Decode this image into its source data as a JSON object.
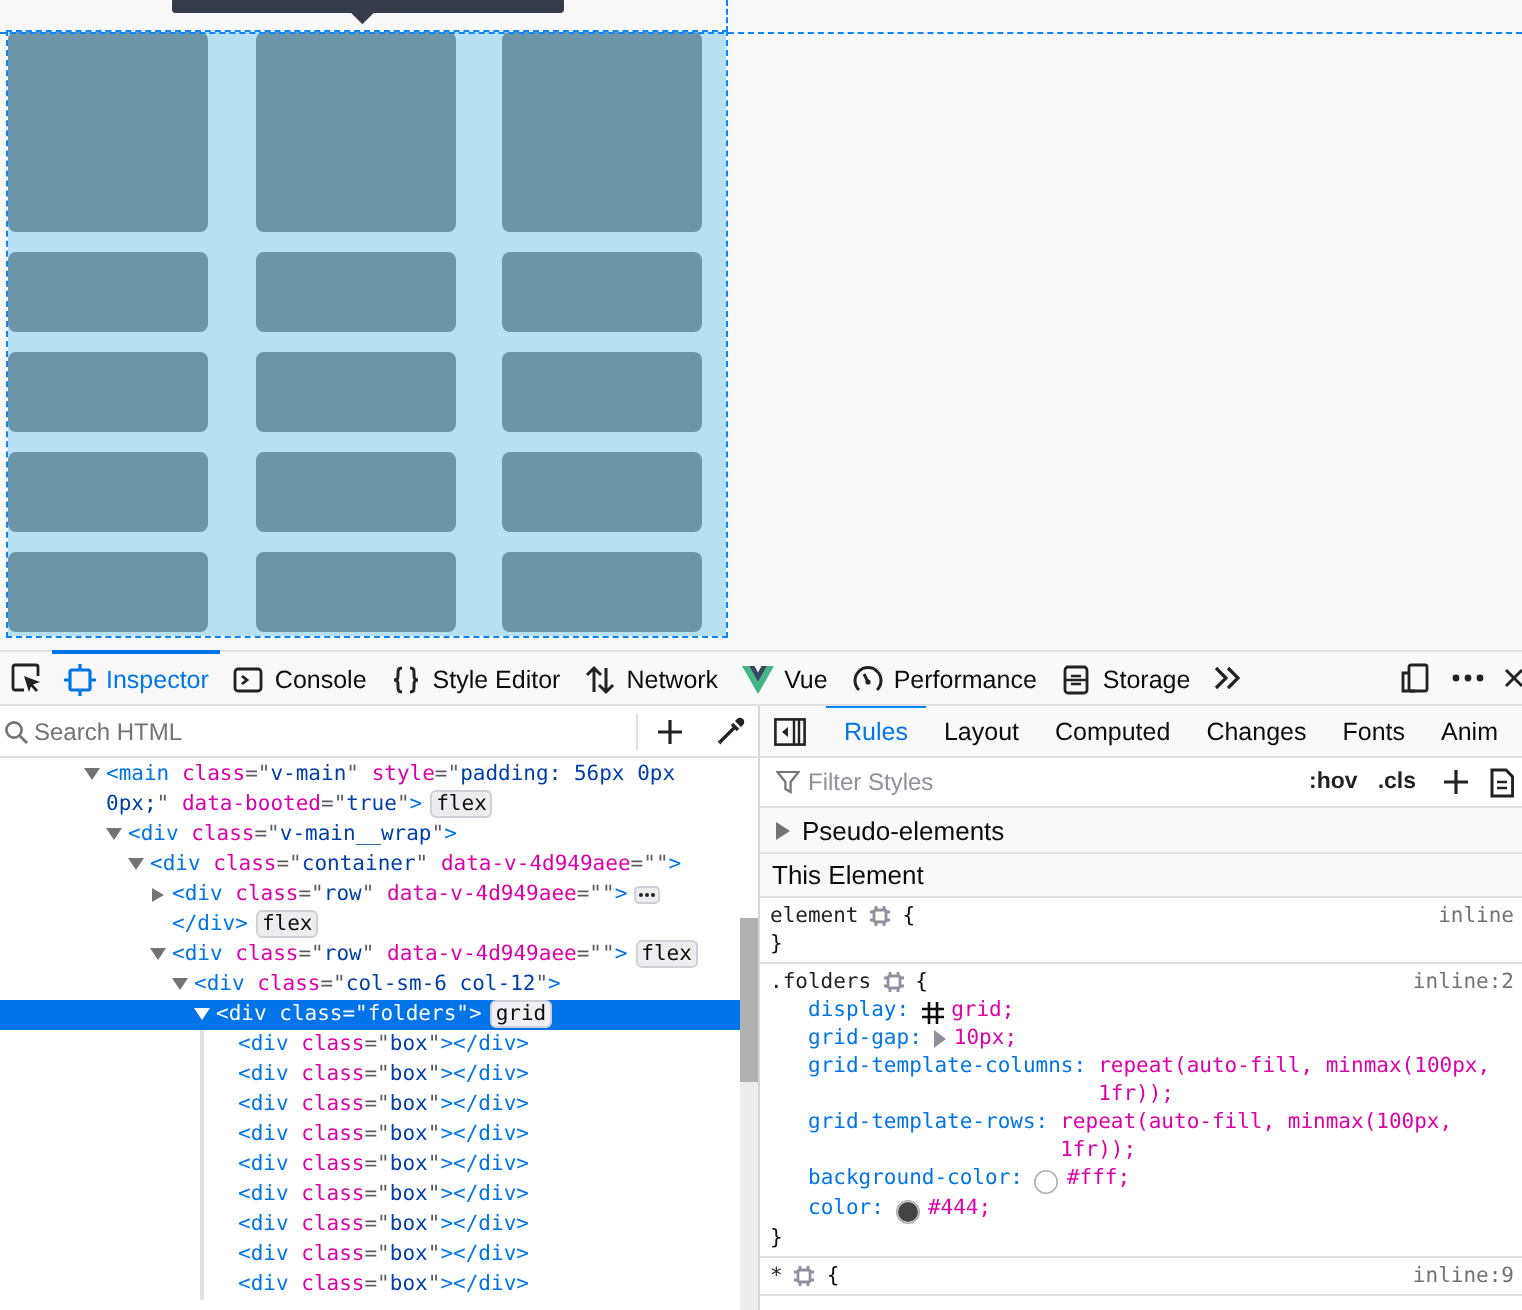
{
  "toolbar": {
    "tabs": [
      {
        "kind": "inspector",
        "label": "Inspector",
        "selected": true
      },
      {
        "kind": "console",
        "label": "Console",
        "selected": false
      },
      {
        "kind": "style-editor",
        "label": "Style Editor",
        "selected": false
      },
      {
        "kind": "network",
        "label": "Network",
        "selected": false
      },
      {
        "kind": "vue",
        "label": "Vue",
        "selected": false
      },
      {
        "kind": "performance",
        "label": "Performance",
        "selected": false
      },
      {
        "kind": "storage",
        "label": "Storage",
        "selected": false
      }
    ]
  },
  "markup_panel": {
    "search": {
      "placeholder": "Search HTML"
    },
    "tree": [
      {
        "open_lines": [
          "<main class=\"v-main\" style=\"padding: 56px 0px",
          "0px;\" data-booted=\"true\">"
        ],
        "badge": "flex",
        "expanded": true,
        "selected": false,
        "children": [
          {
            "open": "<div class=\"v-main__wrap\">",
            "expanded": true,
            "selected": false,
            "children": [
              {
                "open": "<div class=\"container\" data-v-4d949aee=\"\">",
                "expanded": true,
                "selected": false,
                "children": [
                  {
                    "open": "<div class=\"row\" data-v-4d949aee=\"\">",
                    "close": "</div>",
                    "badge": "flex",
                    "expanded": false,
                    "selected": false
                  },
                  {
                    "open": "<div class=\"row\" data-v-4d949aee=\"\">",
                    "badge": "flex",
                    "expanded": true,
                    "selected": false,
                    "children": [
                      {
                        "open": "<div class=\"col-sm-6 col-12\">",
                        "expanded": true,
                        "selected": false,
                        "children": [
                          {
                            "open": "<div class=\"folders\">",
                            "badge": "grid",
                            "expanded": true,
                            "selected": true,
                            "children": [
                              {
                                "open": "<div class=\"box\"></div>",
                                "selected": false
                              },
                              {
                                "open": "<div class=\"box\"></div>",
                                "selected": false
                              },
                              {
                                "open": "<div class=\"box\"></div>",
                                "selected": false
                              },
                              {
                                "open": "<div class=\"box\"></div>",
                                "selected": false
                              },
                              {
                                "open": "<div class=\"box\"></div>",
                                "selected": false
                              },
                              {
                                "open": "<div class=\"box\"></div>",
                                "selected": false
                              },
                              {
                                "open": "<div class=\"box\"></div>",
                                "selected": false
                              },
                              {
                                "open": "<div class=\"box\"></div>",
                                "selected": false
                              },
                              {
                                "open": "<div class=\"box\"></div>",
                                "selected": false
                              }
                            ]
                          }
                        ]
                      }
                    ]
                  }
                ]
              }
            ]
          }
        ]
      }
    ]
  },
  "rules_panel": {
    "tabs": [
      {
        "label": "Rules",
        "selected": true
      },
      {
        "label": "Layout",
        "selected": false
      },
      {
        "label": "Computed",
        "selected": false
      },
      {
        "label": "Changes",
        "selected": false
      },
      {
        "label": "Fonts",
        "selected": false
      },
      {
        "label": "Anim",
        "selected": false
      }
    ],
    "filter": {
      "placeholder": "Filter Styles"
    },
    "toggles": [
      ":hov",
      ".cls"
    ],
    "pseudo_elements": {
      "label": "Pseudo-elements",
      "expanded": false
    },
    "section_title": "This Element",
    "rules": [
      {
        "selector": "element",
        "open": "{",
        "close": "}",
        "source": "inline"
      },
      {
        "selector": ".folders",
        "open": "{",
        "close": "}",
        "source": "inline:2",
        "declarations": [
          {
            "kind": "grid",
            "name": "display:",
            "value": "grid;"
          },
          {
            "kind": "expander",
            "name": "grid-gap:",
            "value": "10px;"
          },
          {
            "kind": "plain",
            "name": "grid-template-columns:",
            "value": "repeat(auto-fill, minmax(100px, 1fr));"
          },
          {
            "kind": "plain",
            "name": "grid-template-rows:",
            "value": "repeat(auto-fill, minmax(100px, 1fr));"
          },
          {
            "kind": "color",
            "name": "background-color:",
            "value": "#fff;",
            "color": "#ffffff"
          },
          {
            "kind": "color",
            "name": "color:",
            "value": "#444;",
            "color": "#444444"
          }
        ]
      },
      {
        "selector": "*",
        "open": "{",
        "source": "inline:9"
      }
    ]
  }
}
